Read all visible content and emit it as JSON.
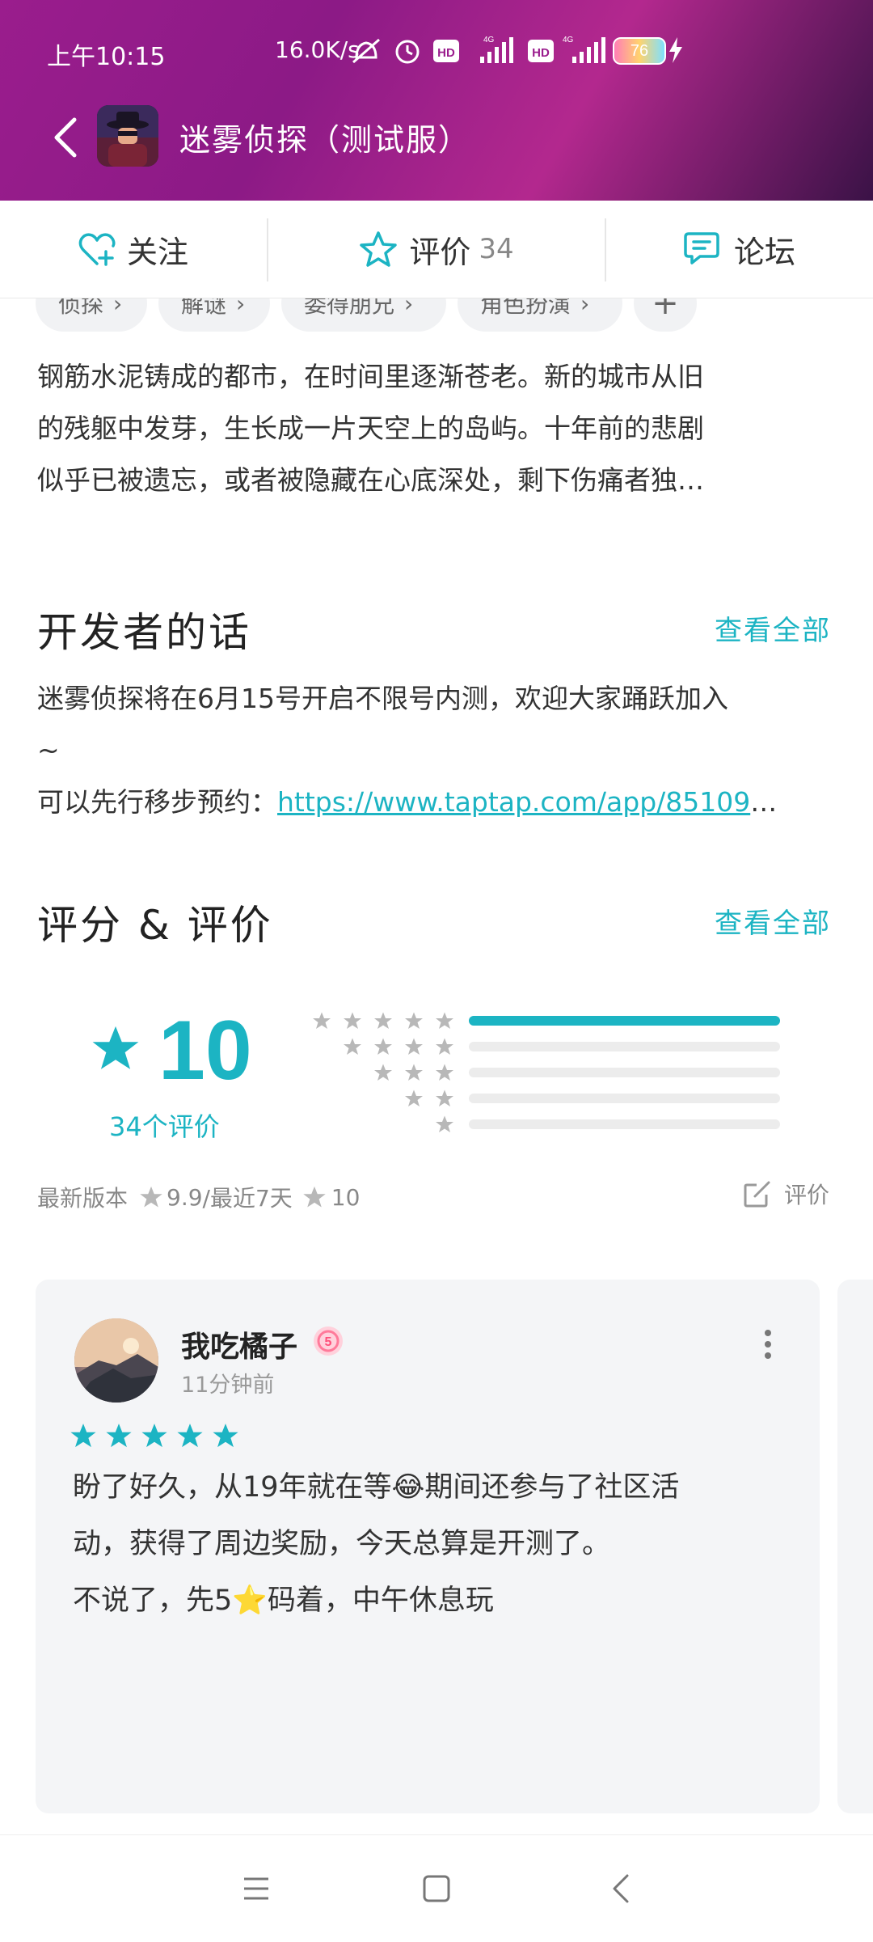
{
  "status_bar": {
    "time": "上午10:15",
    "net_speed": "16.0K/s",
    "battery": "76"
  },
  "header": {
    "title": "迷雾侦探（测试服）"
  },
  "tabs": [
    {
      "label": "关注"
    },
    {
      "label": "评价",
      "count": "34"
    },
    {
      "label": "论坛"
    }
  ],
  "tags": [
    "侦探",
    "解谜",
    "委得朋兄",
    "角色扮演"
  ],
  "description": {
    "line1": "钢筋水泥铸成的都市，在时间里逐渐苍老。新的城市从旧",
    "line2": "的残躯中发芽，生长成一片天空上的岛屿。十年前的悲剧",
    "line3": "似乎已被遗忘，或者被隐藏在心底深处，剩下伤痛者独…"
  },
  "developer": {
    "title": "开发者的话",
    "view_all": "查看全部",
    "line1": "迷雾侦探将在6月15号开启不限号内测，欢迎大家踊跃加入",
    "line2": "~",
    "prefix": "可以先行移步预约：",
    "link": "https://www.taptap.com/app/85109",
    "ellipsis": "…"
  },
  "ratings": {
    "title": "评分 & 评价",
    "view_all": "查看全部",
    "score": "10",
    "count_label": "34个评价",
    "distribution": [
      1.0,
      0.0,
      0.0,
      0.0,
      0.0
    ],
    "latest_label": "最新版本",
    "latest_score": "9.9",
    "recent_label": "/最近7天",
    "recent_score": "10",
    "write_label": "评价"
  },
  "review": {
    "username": "我吃橘子",
    "time": "11分钟前",
    "stars": 5,
    "line1": "盼了好久，从19年就在等😂期间还参与了社区活",
    "line2": "动，获得了周边奖励，今天总算是开测了。",
    "line3": "不说了，先5⭐码着，中午休息玩"
  },
  "colors": {
    "accent": "#1cb4c3",
    "header_gradient_start": "#9a1d8d",
    "header_gradient_end": "#3a1246"
  }
}
